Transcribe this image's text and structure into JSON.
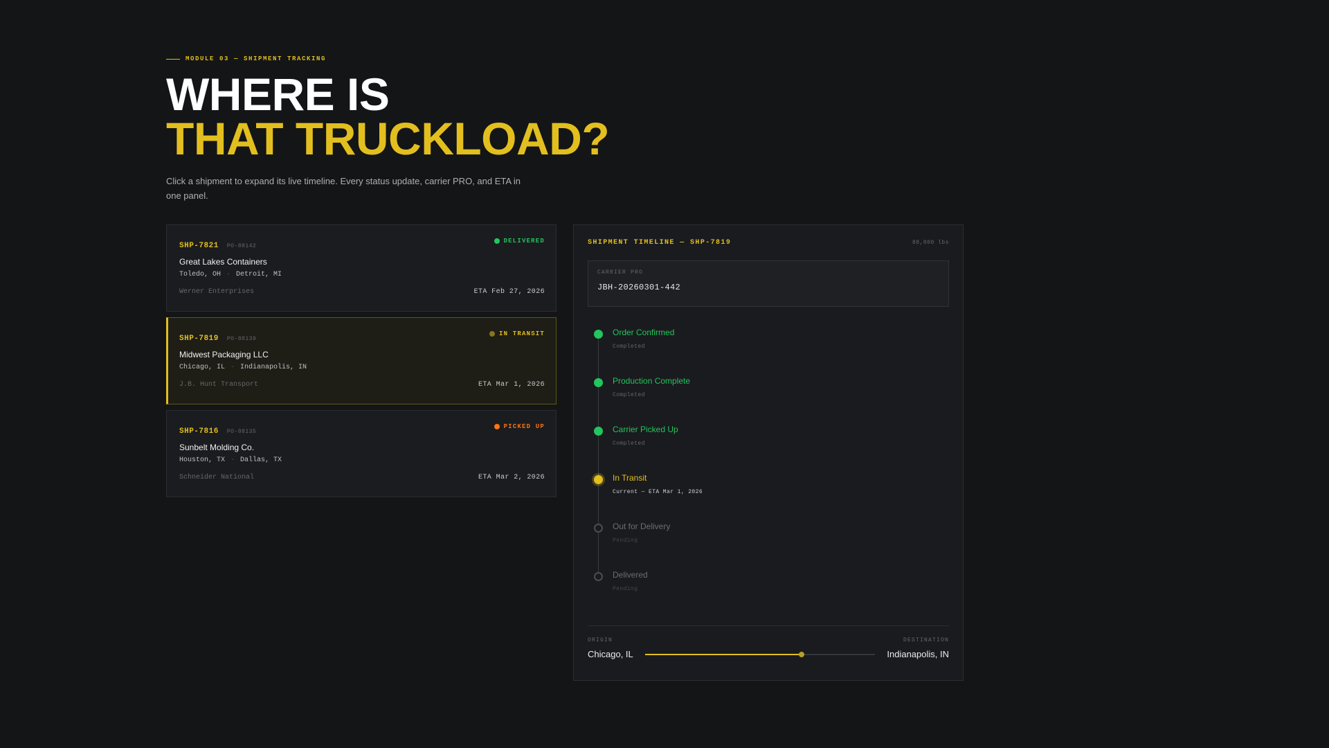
{
  "header": {
    "eyebrow": "MODULE 03 — SHIPMENT TRACKING",
    "title_line1": "WHERE IS",
    "title_line2": "THAT TRUCKLOAD?",
    "description": "Click a shipment to expand its live timeline. Every status update, carrier PRO, and ETA in one panel."
  },
  "shipments": [
    {
      "id": "SHP-7821",
      "po": "PO-88142",
      "status": "DELIVERED",
      "status_color": "#22c55e",
      "customer": "Great Lakes Containers",
      "origin": "Toledo, OH",
      "route_sep": "·",
      "destination": "Detroit, MI",
      "carrier": "Werner Enterprises",
      "eta": "ETA Feb 27, 2026"
    },
    {
      "id": "SHP-7819",
      "po": "PO-88139",
      "status": "IN TRANSIT",
      "status_color": "#e2bf1e",
      "dot_color": "#8a7420",
      "customer": "Midwest Packaging LLC",
      "origin": "Chicago, IL",
      "route_sep": "·",
      "destination": "Indianapolis, IN",
      "carrier": "J.B. Hunt Transport",
      "eta": "ETA Mar 1, 2026",
      "active": true
    },
    {
      "id": "SHP-7816",
      "po": "PO-88135",
      "status": "PICKED UP",
      "status_color": "#f97316",
      "customer": "Sunbelt Molding Co.",
      "origin": "Houston, TX",
      "route_sep": "·",
      "destination": "Dallas, TX",
      "carrier": "Schneider National",
      "eta": "ETA Mar 2, 2026"
    }
  ],
  "panel": {
    "title": "SHIPMENT TIMELINE — SHP-7819",
    "weight": "88,000 lbs",
    "carrier_pro_label": "CARRIER PRO",
    "carrier_pro_value": "JBH-20260301-442",
    "steps": [
      {
        "name": "Order Confirmed",
        "sub": "Completed",
        "state": "done"
      },
      {
        "name": "Production Complete",
        "sub": "Completed",
        "state": "done"
      },
      {
        "name": "Carrier Picked Up",
        "sub": "Completed",
        "state": "done"
      },
      {
        "name": "In Transit",
        "sub": "Current — ETA Mar 1, 2026",
        "state": "current"
      },
      {
        "name": "Out for Delivery",
        "sub": "Pending",
        "state": "pending"
      },
      {
        "name": "Delivered",
        "sub": "Pending",
        "state": "pending"
      }
    ],
    "origin_label": "ORIGIN",
    "destination_label": "DESTINATION",
    "origin_city": "Chicago, IL",
    "destination_city": "Indianapolis, IN",
    "route_progress": 0.68
  }
}
